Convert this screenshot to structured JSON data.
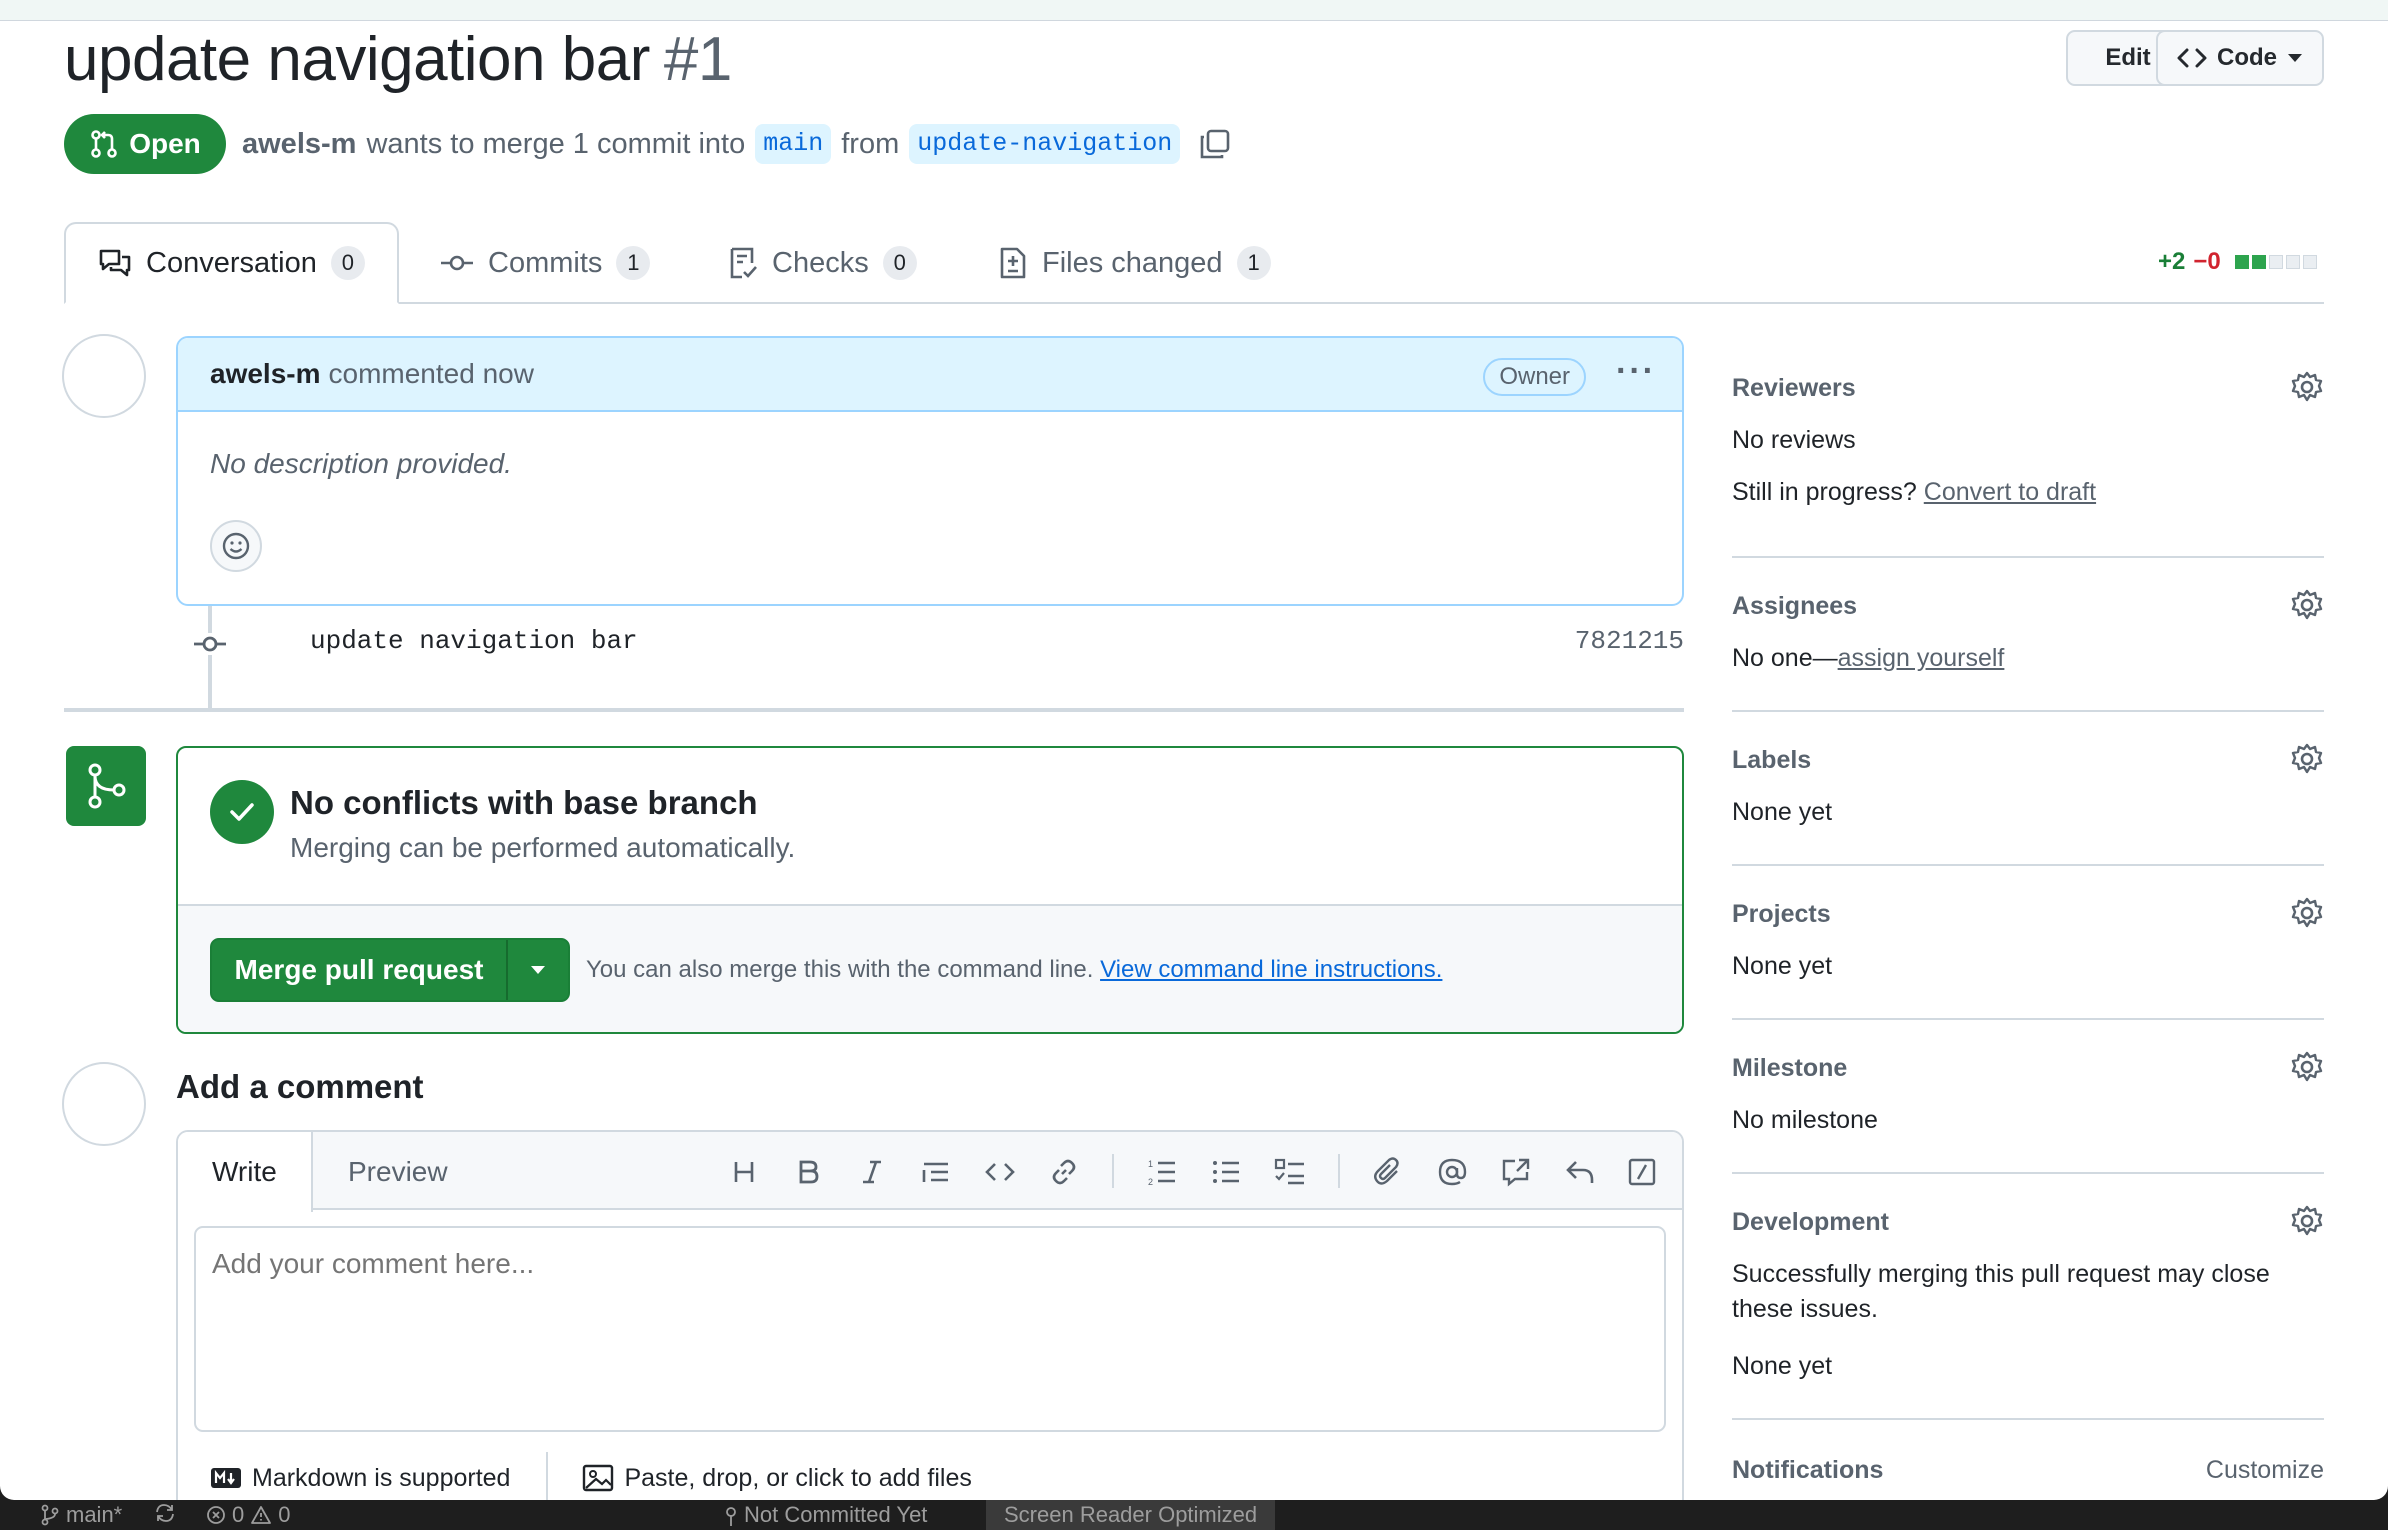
{
  "header": {
    "title": "update navigation bar",
    "number": "#1",
    "edit_label": "Edit",
    "code_label": "Code"
  },
  "status": {
    "state": "Open",
    "author": "awels-m",
    "merge_text": "wants to merge 1 commit into",
    "base_branch": "main",
    "from_text": "from",
    "head_branch": "update-navigation"
  },
  "tabs": [
    {
      "label": "Conversation",
      "count": "0"
    },
    {
      "label": "Commits",
      "count": "1"
    },
    {
      "label": "Checks",
      "count": "0"
    },
    {
      "label": "Files changed",
      "count": "1"
    }
  ],
  "diffstat": {
    "additions": "+2",
    "deletions": "−0",
    "blocks_green": 2,
    "blocks_total": 5
  },
  "comment": {
    "author": "awels-m",
    "action": "commented now",
    "badge": "Owner",
    "body": "No description provided."
  },
  "commit": {
    "message": "update navigation bar",
    "sha": "7821215"
  },
  "merge": {
    "heading": "No conflicts with base branch",
    "subtext": "Merging can be performed automatically.",
    "button_label": "Merge pull request",
    "note": "You can also merge this with the command line.",
    "link": "View command line instructions."
  },
  "add_comment": {
    "heading": "Add a comment",
    "write_tab": "Write",
    "preview_tab": "Preview",
    "placeholder": "Add your comment here...",
    "markdown_note": "Markdown is supported",
    "upload_note": "Paste, drop, or click to add files"
  },
  "sidebar": {
    "reviewers": {
      "title": "Reviewers",
      "value": "No reviews",
      "progress_text": "Still in progress?",
      "progress_link": "Convert to draft"
    },
    "assignees": {
      "title": "Assignees",
      "value_prefix": "No one—",
      "value_link": "assign yourself"
    },
    "labels": {
      "title": "Labels",
      "value": "None yet"
    },
    "projects": {
      "title": "Projects",
      "value": "None yet"
    },
    "milestone": {
      "title": "Milestone",
      "value": "No milestone"
    },
    "development": {
      "title": "Development",
      "line1": "Successfully merging this pull request may close",
      "line2": "these issues.",
      "value": "None yet"
    },
    "notifications": {
      "title": "Notifications",
      "action": "Customize"
    }
  },
  "statusbar": {
    "branch": "main*",
    "errors": "0",
    "warnings": "0",
    "blame": "Not Committed Yet",
    "screen_reader": "Screen Reader Optimized"
  },
  "colors": {
    "accent_green": "#1f883d",
    "link_blue": "#0969da",
    "comment_header": "#ddf4ff"
  }
}
